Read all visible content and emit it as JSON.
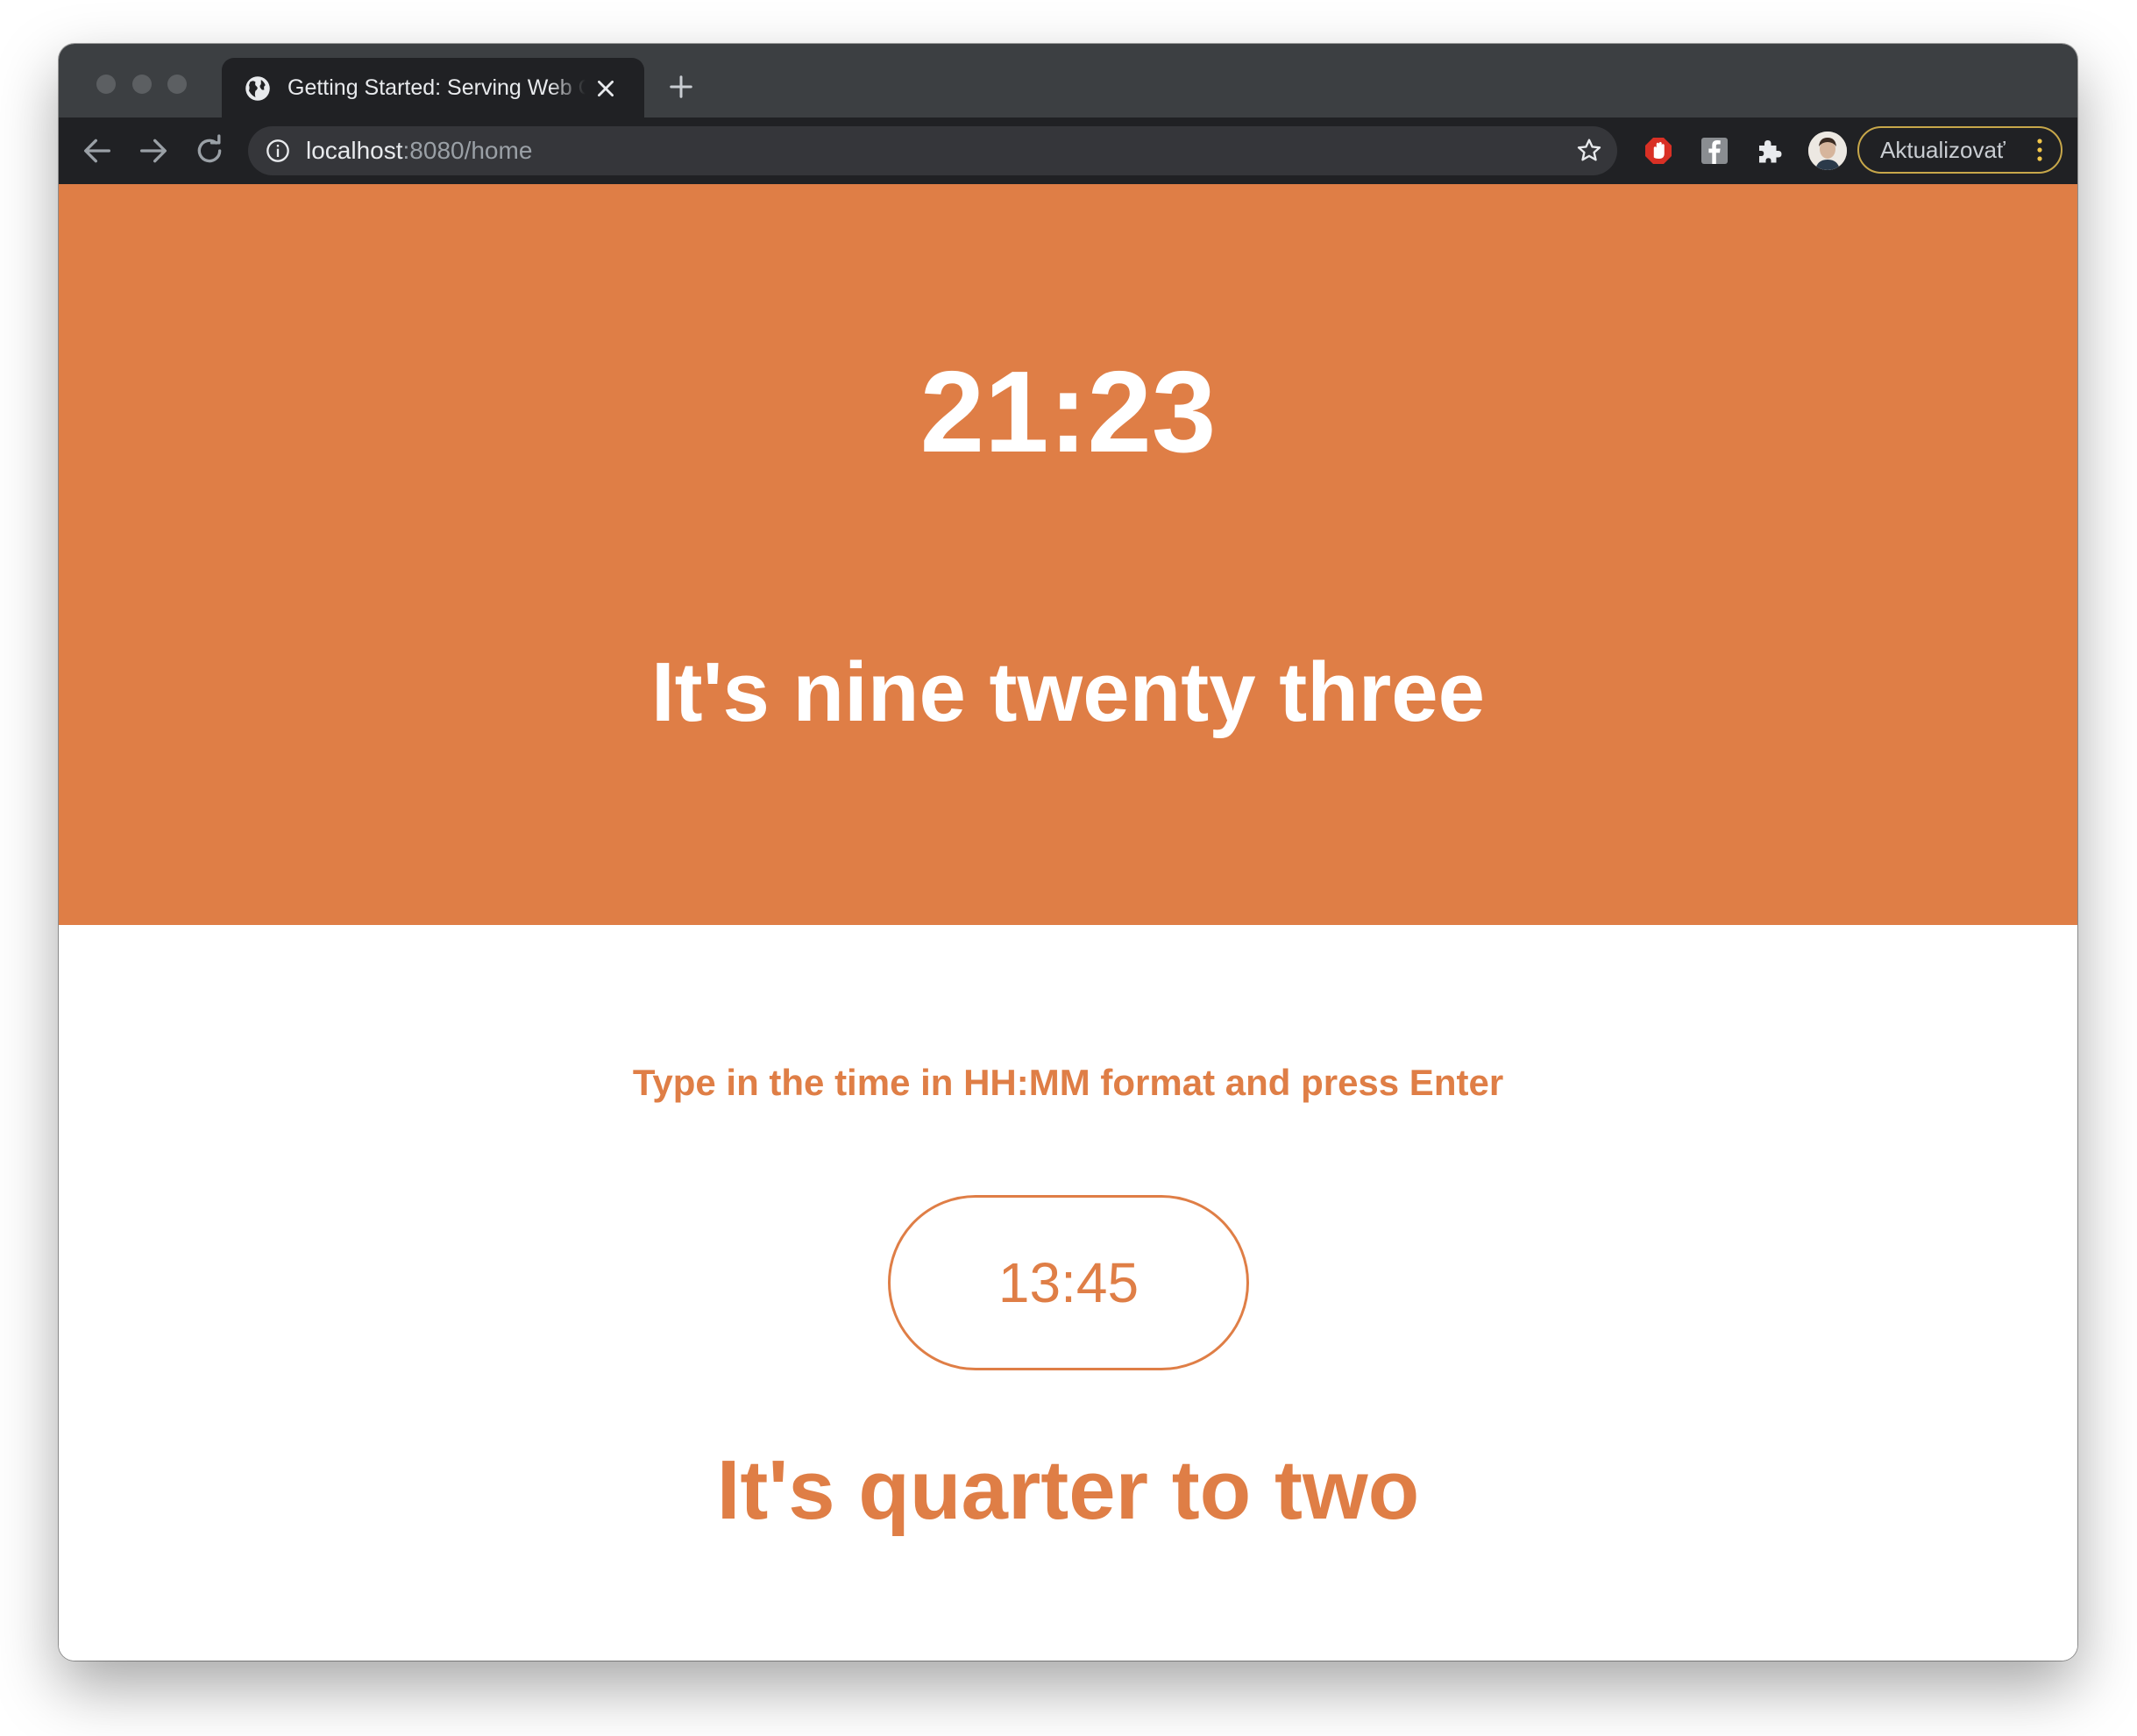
{
  "browser": {
    "tab": {
      "title": "Getting Started: Serving Web Content"
    },
    "address_bar": {
      "host": "localhost",
      "rest": ":8080/home"
    },
    "update_button_label": "Aktualizovať",
    "icons": [
      "globe-icon",
      "close-icon",
      "plus-icon",
      "arrow-left-icon",
      "arrow-right-icon",
      "reload-icon",
      "info-icon",
      "star-icon",
      "adblock-icon",
      "facebook-icon",
      "puzzle-icon",
      "avatar",
      "kebab-icon"
    ]
  },
  "page": {
    "clock": {
      "time": "21:23",
      "words": "It's nine twenty three"
    },
    "converter": {
      "prompt": "Type in the time in HH:MM format and press Enter",
      "input_value": "13:45",
      "result": "It's quarter to two"
    }
  },
  "colors": {
    "accent": "#df7e46",
    "tab_strip": "#3c3f42",
    "toolbar": "#202124",
    "omnibox": "#35363a"
  }
}
